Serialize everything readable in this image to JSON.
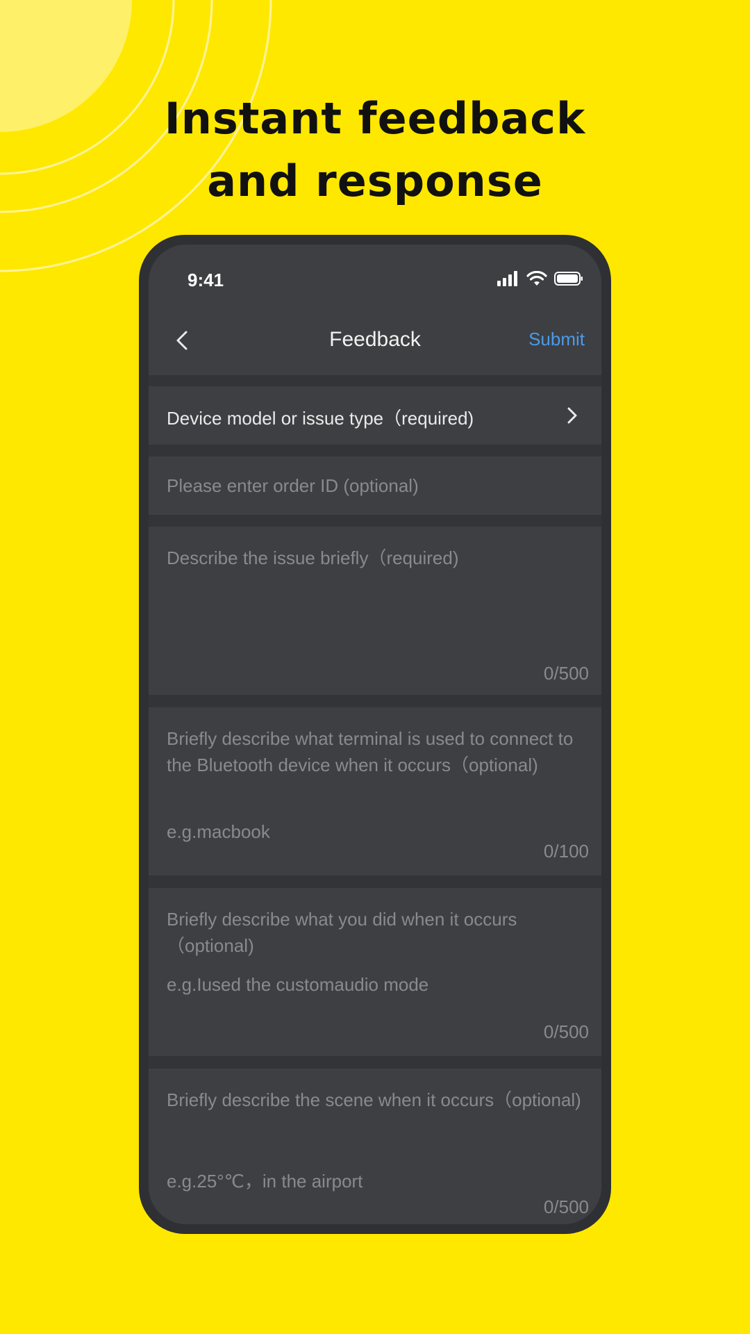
{
  "promo": {
    "headline_line1": "Instant feedback",
    "headline_line2": "and response"
  },
  "status_bar": {
    "time": "9:41",
    "icons": [
      "signal-icon",
      "wifi-icon",
      "battery-icon"
    ]
  },
  "nav": {
    "back_icon": "chevron-left-icon",
    "title": "Feedback",
    "submit_label": "Submit"
  },
  "form": {
    "device_select_label": "Device model or issue type（required)",
    "order_id": {
      "value": "",
      "placeholder": "Please enter order ID (optional)"
    },
    "description": {
      "value": "",
      "placeholder": "Describe the issue briefly（required)",
      "counter": "0/500"
    },
    "terminal": {
      "value": "",
      "placeholder": "Briefly describe what terminal is used to connect to the Bluetooth device when it occurs（optional)",
      "example": "e.g.macbook",
      "counter": "0/100"
    },
    "action": {
      "value": "",
      "placeholder": "Briefly describe what you did when it occurs（optional)",
      "example": "e.g.Iused the customaudio mode",
      "counter": "0/500"
    },
    "scene": {
      "value": "",
      "placeholder": "Briefly describe the scene when it occurs（optional)",
      "example": "e.g.25°℃，in the airport",
      "counter": "0/500"
    }
  },
  "colors": {
    "background": "#FFE800",
    "phone_frame": "#2f3033",
    "card": "#3e3f43",
    "accent": "#4a9be8",
    "placeholder": "#8a8a8d"
  }
}
